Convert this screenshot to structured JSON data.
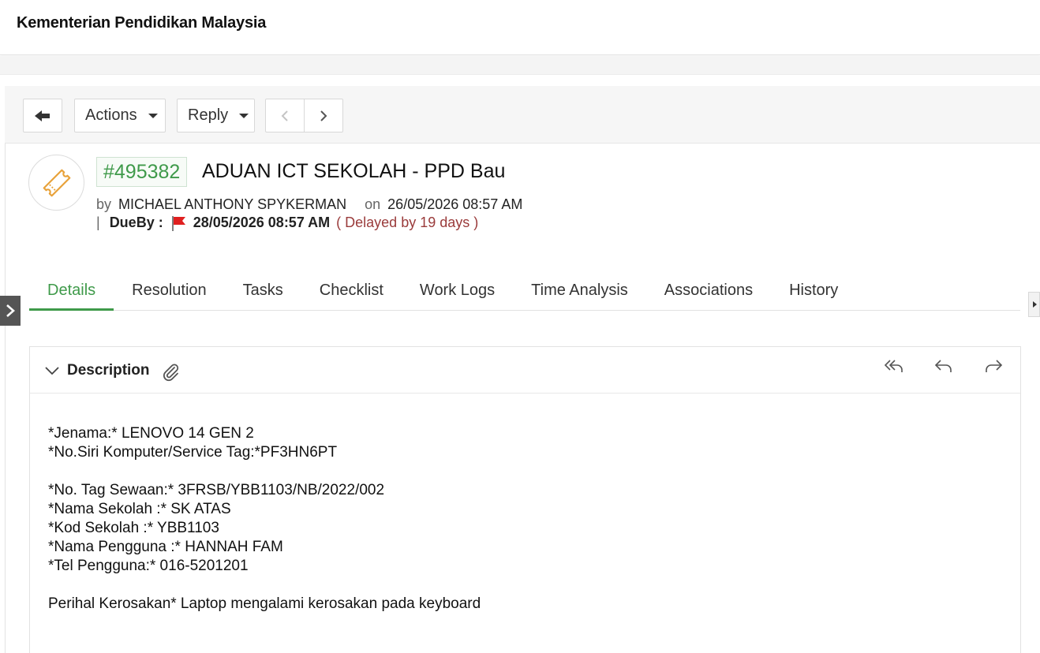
{
  "header": {
    "org_name": "Kementerian Pendidikan Malaysia"
  },
  "toolbar": {
    "back_icon": "back-arrow-icon",
    "actions_label": "Actions",
    "reply_label": "Reply",
    "prev_icon": "chevron-left-icon",
    "next_icon": "chevron-right-icon"
  },
  "ticket": {
    "icon": "ticket-icon",
    "icon_color": "#e8a23a",
    "id": "#495382",
    "title": "ADUAN ICT SEKOLAH - PPD Bau",
    "by_label": "by",
    "author": "MICHAEL ANTHONY SPYKERMAN",
    "on_label": "on",
    "created": "26/05/2026 08:57 AM",
    "sep": "|",
    "dueby_label": "DueBy :",
    "flag_color": "#e02020",
    "due_date": "28/05/2026 08:57 AM",
    "delay_text": "( Delayed by 19 days )",
    "id_color": "#3f9a4a"
  },
  "tabs": [
    {
      "label": "Details",
      "active": true
    },
    {
      "label": "Resolution"
    },
    {
      "label": "Tasks"
    },
    {
      "label": "Checklist"
    },
    {
      "label": "Work Logs"
    },
    {
      "label": "Time Analysis"
    },
    {
      "label": "Associations"
    },
    {
      "label": "History"
    }
  ],
  "description": {
    "title": "Description",
    "lines": [
      "*Jenama:* LENOVO 14 GEN 2",
      "*No.Siri Komputer/Service Tag:*PF3HN6PT",
      "",
      "*No. Tag Sewaan:* 3FRSB/YBB1103/NB/2022/002",
      "*Nama Sekolah :* SK ATAS",
      "*Kod Sekolah :* YBB1103",
      "*Nama Pengguna :* HANNAH FAM",
      "*Tel Pengguna:* 016-5201201",
      "",
      "Perihal Kerosakan* Laptop mengalami kerosakan pada keyboard"
    ]
  },
  "colors": {
    "accent": "#3f9a4a",
    "delay": "#9a3b3b"
  }
}
